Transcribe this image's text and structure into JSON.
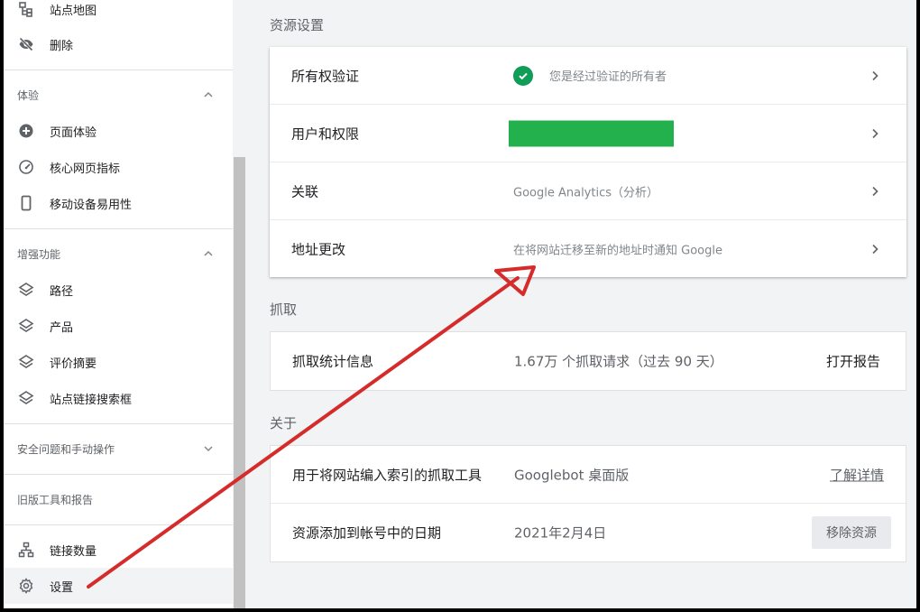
{
  "sidebar": {
    "items_top": [
      {
        "label": "站点地图",
        "icon": "sitemap-icon"
      },
      {
        "label": "删除",
        "icon": "eye-off-icon"
      }
    ],
    "experience": {
      "header": "体验",
      "items": [
        {
          "label": "页面体验",
          "icon": "plus-circle-icon"
        },
        {
          "label": "核心网页指标",
          "icon": "speedometer-icon"
        },
        {
          "label": "移动设备易用性",
          "icon": "phone-icon"
        }
      ]
    },
    "enhancements": {
      "header": "增强功能",
      "items": [
        {
          "label": "路径",
          "icon": "layers-icon"
        },
        {
          "label": "产品",
          "icon": "layers-icon"
        },
        {
          "label": "评价摘要",
          "icon": "layers-icon"
        },
        {
          "label": "站点链接搜索框",
          "icon": "layers-icon"
        }
      ]
    },
    "security_header": "安全问题和手动操作",
    "legacy_header": "旧版工具和报告",
    "items_bottom": [
      {
        "label": "链接数量",
        "icon": "network-icon"
      },
      {
        "label": "设置",
        "icon": "gear-icon"
      }
    ]
  },
  "main": {
    "resource_settings": {
      "title": "资源设置",
      "rows": [
        {
          "key": "所有权验证",
          "value": "您是经过验证的所有者"
        },
        {
          "key": "用户和权限",
          "value": ""
        },
        {
          "key": "关联",
          "value": "Google Analytics（分析）"
        },
        {
          "key": "地址更改",
          "value": "在将网站迁移至新的地址时通知 Google"
        }
      ]
    },
    "crawl": {
      "title": "抓取",
      "rows": [
        {
          "key": "抓取统计信息",
          "value": "1.67万 个抓取请求（过去 90 天）",
          "action": "打开报告"
        }
      ]
    },
    "about": {
      "title": "关于",
      "rows": [
        {
          "key": "用于将网站编入索引的抓取工具",
          "value": "Googlebot 桌面版",
          "action": "了解详情"
        },
        {
          "key": "资源添加到帐号中的日期",
          "value": "2021年2月4日",
          "action": "移除资源"
        }
      ]
    }
  },
  "colors": {
    "verified_check": "#0f9d58",
    "redaction_block": "#22b14c",
    "annotation_arrow": "#d62b2b"
  }
}
